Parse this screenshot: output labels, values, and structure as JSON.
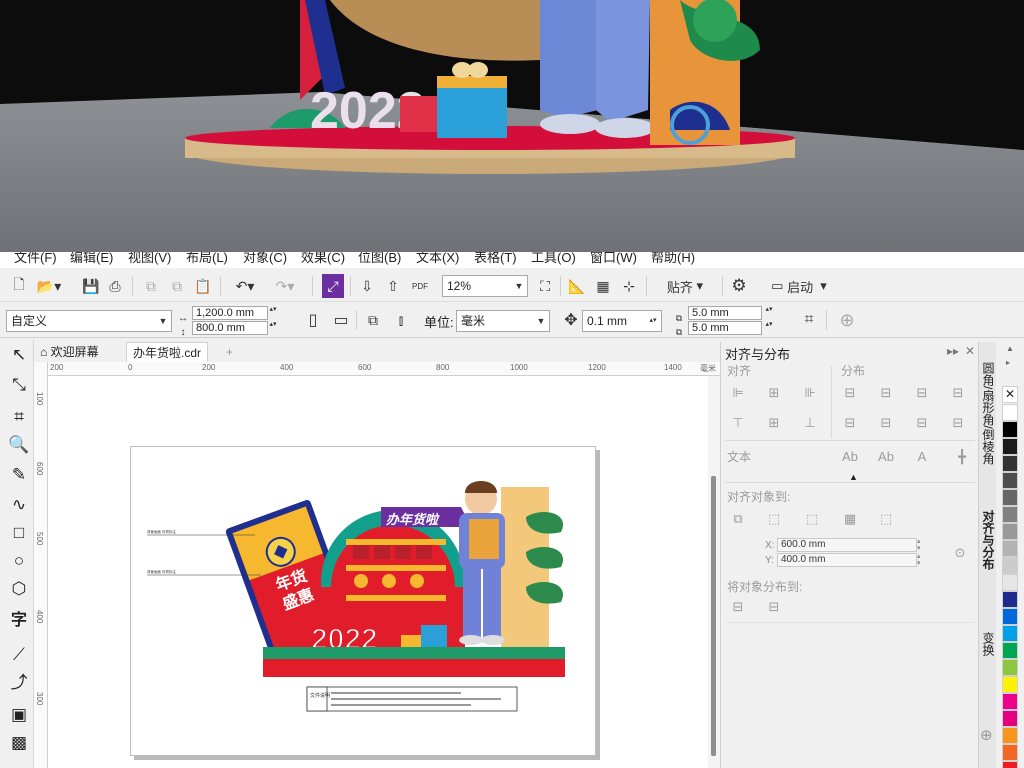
{
  "render": {
    "year_text": "2022",
    "banner_text": "办年货啦"
  },
  "menubar": {
    "items": [
      "文件(F)",
      "编辑(E)",
      "视图(V)",
      "布局(L)",
      "对象(C)",
      "效果(C)",
      "位图(B)",
      "文本(X)",
      "表格(T)",
      "工具(O)",
      "窗口(W)",
      "帮助(H)"
    ]
  },
  "toolbar1": {
    "zoom_value": "12%",
    "snap_label": "贴齐",
    "launch_label": "启动",
    "pdf_label": "PDF"
  },
  "toolbar2": {
    "page_size": "自定义",
    "width": "1,200.0 mm",
    "height": "800.0 mm",
    "unit_label": "单位:",
    "unit_value": "毫米",
    "nudge": "0.1 mm",
    "dup_x": "5.0 mm",
    "dup_y": "5.0 mm"
  },
  "tabs": {
    "welcome": "欢迎屏幕",
    "document": "办年货啦.cdr",
    "add": "+"
  },
  "ruler": {
    "ticks": [
      "200",
      "0",
      "200",
      "400",
      "600",
      "800",
      "1000",
      "1200",
      "1400"
    ],
    "unit": "毫米"
  },
  "artwork": {
    "year": "2022",
    "sign": "办年货啦",
    "red_packet_text": "年货盛惠",
    "info_label": "文件说明"
  },
  "docker": {
    "title": "对齐与分布",
    "align_section": "对齐",
    "distribute_section": "分布",
    "text_section": "文本",
    "align_to_label": "对齐对象到:",
    "x_value": "600.0 mm",
    "y_value": "400.0 mm",
    "distribute_to_label": "将对象分布到:"
  },
  "vtabs": {
    "items": [
      "圆角/扇形角/倒棱角",
      "对齐与分布",
      "变换"
    ]
  },
  "palette": {
    "colors": [
      "#ffffff",
      "#000000",
      "#1a1a1a",
      "#333333",
      "#4d4d4d",
      "#666666",
      "#808080",
      "#999999",
      "#b3b3b3",
      "#cccccc",
      "#e6e6e6",
      "#1e2a8c",
      "#0069d9",
      "#00a0e9",
      "#00a651",
      "#8dc63f",
      "#fff200",
      "#ec008c",
      "#e4007f",
      "#f7941d",
      "#f26522",
      "#ed1c24"
    ]
  }
}
